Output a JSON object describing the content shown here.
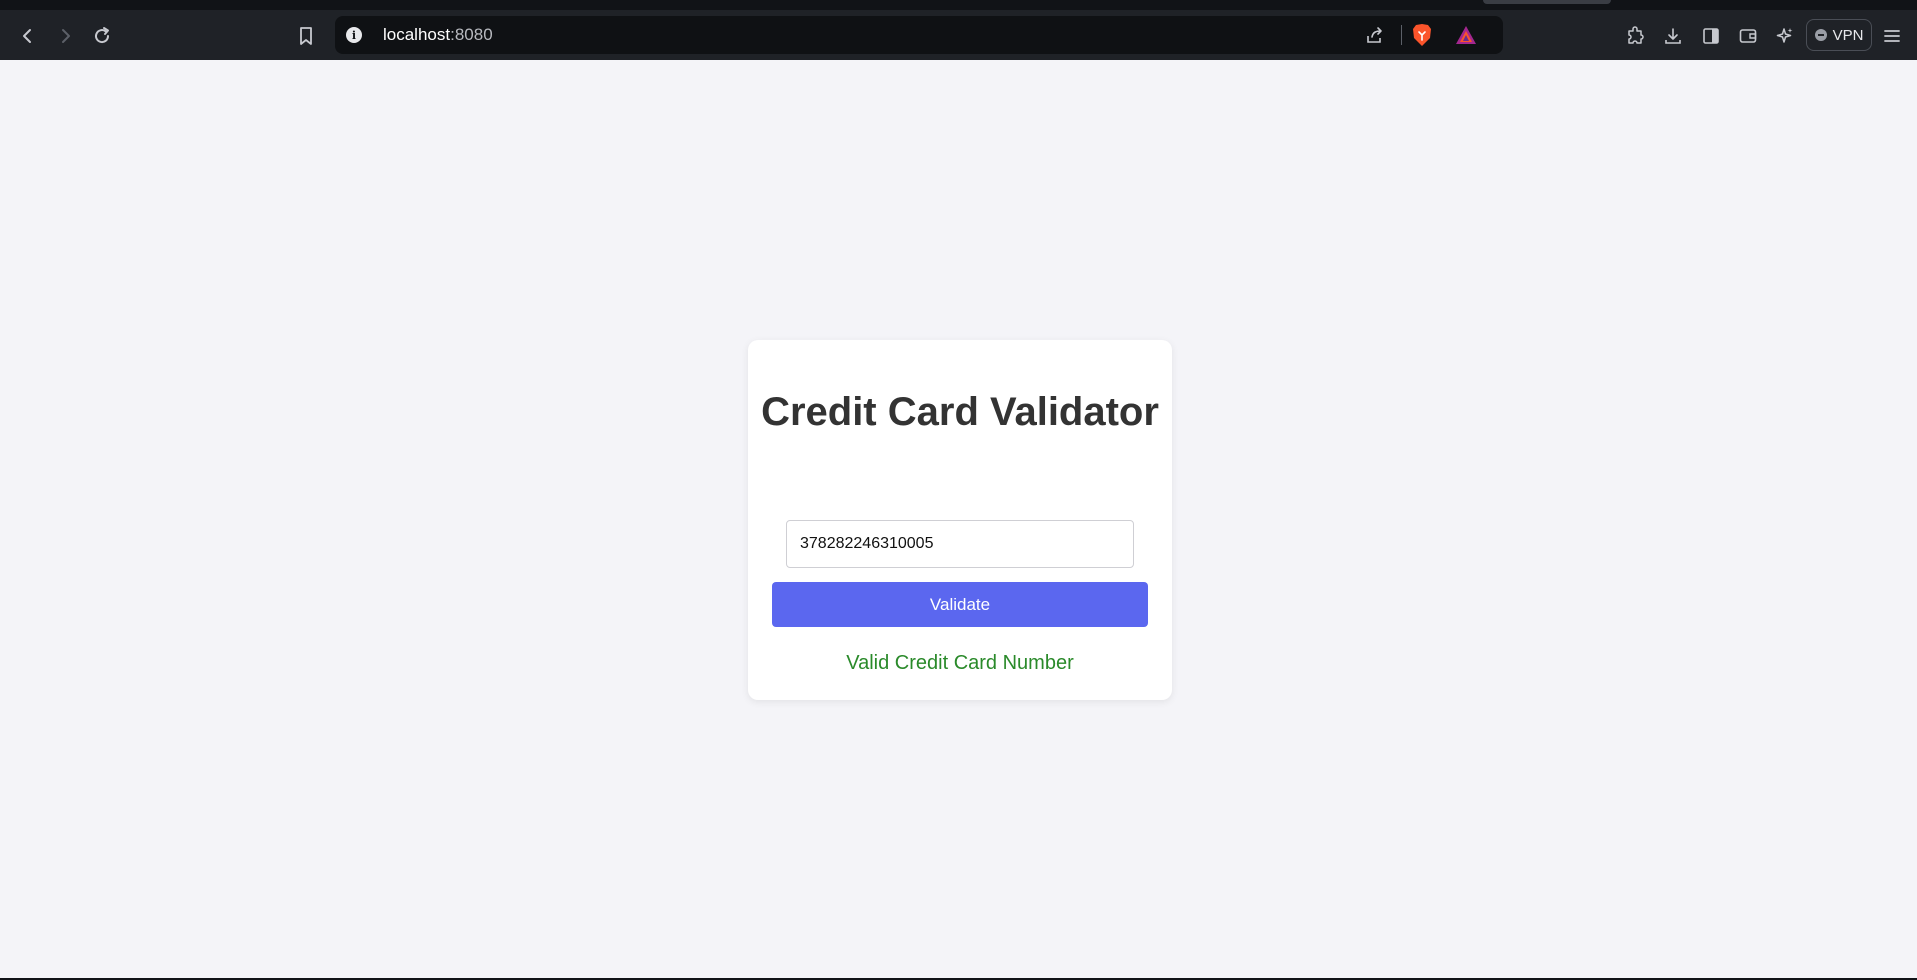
{
  "browser": {
    "url_host": "localhost",
    "url_port": ":8080",
    "vpn_label": "VPN"
  },
  "page": {
    "title": "Credit Card Validator",
    "card_input_value": "378282246310005",
    "validate_label": "Validate",
    "result_text": "Valid Credit Card Number",
    "result_color": "#2a8a2a",
    "button_color": "#5b67ef"
  }
}
